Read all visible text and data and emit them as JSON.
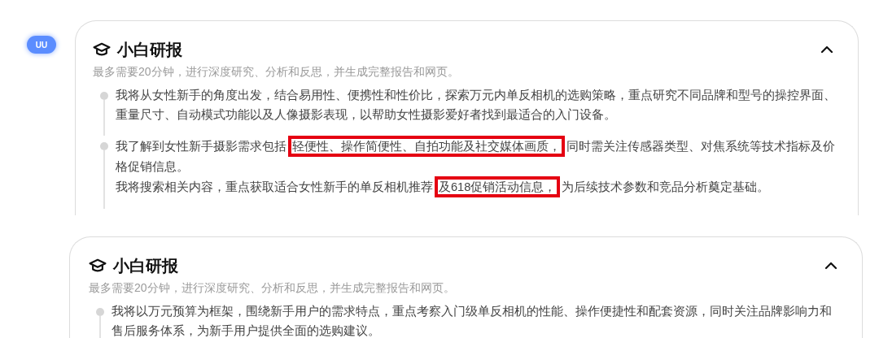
{
  "assistant_logo": {
    "text": "UU"
  },
  "cards": [
    {
      "title": "小白研报",
      "subtitle": "最多需要20分钟，进行深度研究、分析和反思，并生成完整报告和网页。",
      "expanded": true,
      "steps": [
        {
          "paragraphs": [
            [
              {
                "text": "我将从女性新手的角度出发，结合易用性、便携性和性价比，探索万元内单反相机的选购策略，重点研究不同品牌和型号的操控界面、重量尺寸、自动模式功能以及人像摄影表现，以帮助女性摄影爱好者找到最适合的入门设备。",
                "highlighted": false
              }
            ]
          ]
        },
        {
          "paragraphs": [
            [
              {
                "text": "我了解到女性新手摄影需求包括",
                "highlighted": false
              },
              {
                "text": "轻便性、操作简便性、自拍功能及社交媒体画质，",
                "highlighted": true
              },
              {
                "text": "同时需关注传感器类型、对焦系统等技术指标及价格促销信息。",
                "highlighted": false
              }
            ],
            [
              {
                "text": "我将搜索相关内容，重点获取适合女性新手的单反相机推荐",
                "highlighted": false
              },
              {
                "text": "及618促销活动信息，",
                "highlighted": true
              },
              {
                "text": "为后续技术参数和竞品分析奠定基础。",
                "highlighted": false
              }
            ]
          ]
        }
      ]
    },
    {
      "title": "小白研报",
      "subtitle": "最多需要20分钟，进行深度研究、分析和反思，并生成完整报告和网页。",
      "expanded": true,
      "steps": [
        {
          "paragraphs": [
            [
              {
                "text": "我将以万元预算为框架，围绕新手用户的需求特点，重点考察入门级单反相机的性能、操作便捷性和配套资源，同时关注品牌影响力和售后服务体系，为新手用户提供全面的选购建议。",
                "highlighted": false
              }
            ]
          ]
        }
      ]
    }
  ]
}
